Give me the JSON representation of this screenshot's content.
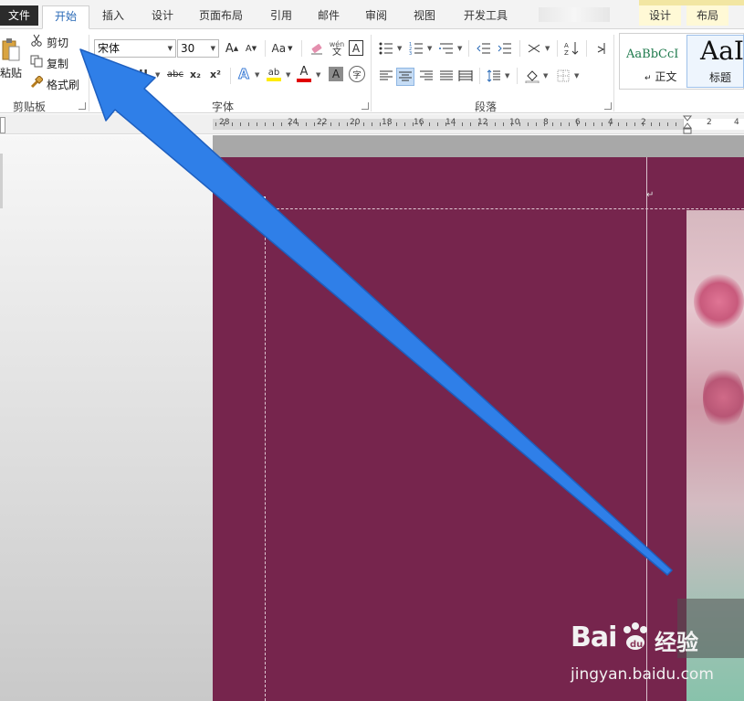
{
  "tabs": {
    "file": "文件",
    "home": "开始",
    "insert": "插入",
    "design": "设计",
    "page_layout": "页面布局",
    "references": "引用",
    "mailings": "邮件",
    "review": "审阅",
    "view": "视图",
    "developer": "开发工具",
    "ctx_design": "设计",
    "ctx_layout": "布局"
  },
  "clipboard": {
    "paste": "粘贴",
    "cut": "剪切",
    "copy": "复制",
    "format_painter": "格式刷",
    "group_label": "剪贴板"
  },
  "font": {
    "name": "宋体",
    "size": "30",
    "group_label": "字体",
    "grow": "A",
    "shrink": "A",
    "case": "Aa",
    "phonetic_top": "wén",
    "phonetic_bottom": "文",
    "border_char": "A",
    "bold": "B",
    "italic": "I",
    "underline": "U",
    "strike": "abc",
    "subscript": "x₂",
    "superscript": "x²",
    "effect": "A",
    "highlight": "ab",
    "color": "A",
    "shade": "A",
    "enclose": "字"
  },
  "paragraph": {
    "group_label": "段落"
  },
  "styles": {
    "normal_preview": "AaBbCcI",
    "normal_label": "正文",
    "heading_preview": "AaI",
    "heading_label": "标题"
  },
  "ruler": {
    "left_numbers": [
      "28",
      "24",
      "22",
      "20",
      "18",
      "16",
      "14",
      "12",
      "10",
      "8",
      "6",
      "4",
      "2"
    ],
    "right_numbers": [
      "2",
      "4"
    ]
  },
  "watermark": {
    "logo": "Bai",
    "logo_cn": "经验",
    "url": "jingyan.baidu.com"
  },
  "colors": {
    "page": "#76254d",
    "arrow": "#2f7fe8",
    "tab_active_text": "#2a6ab7"
  }
}
